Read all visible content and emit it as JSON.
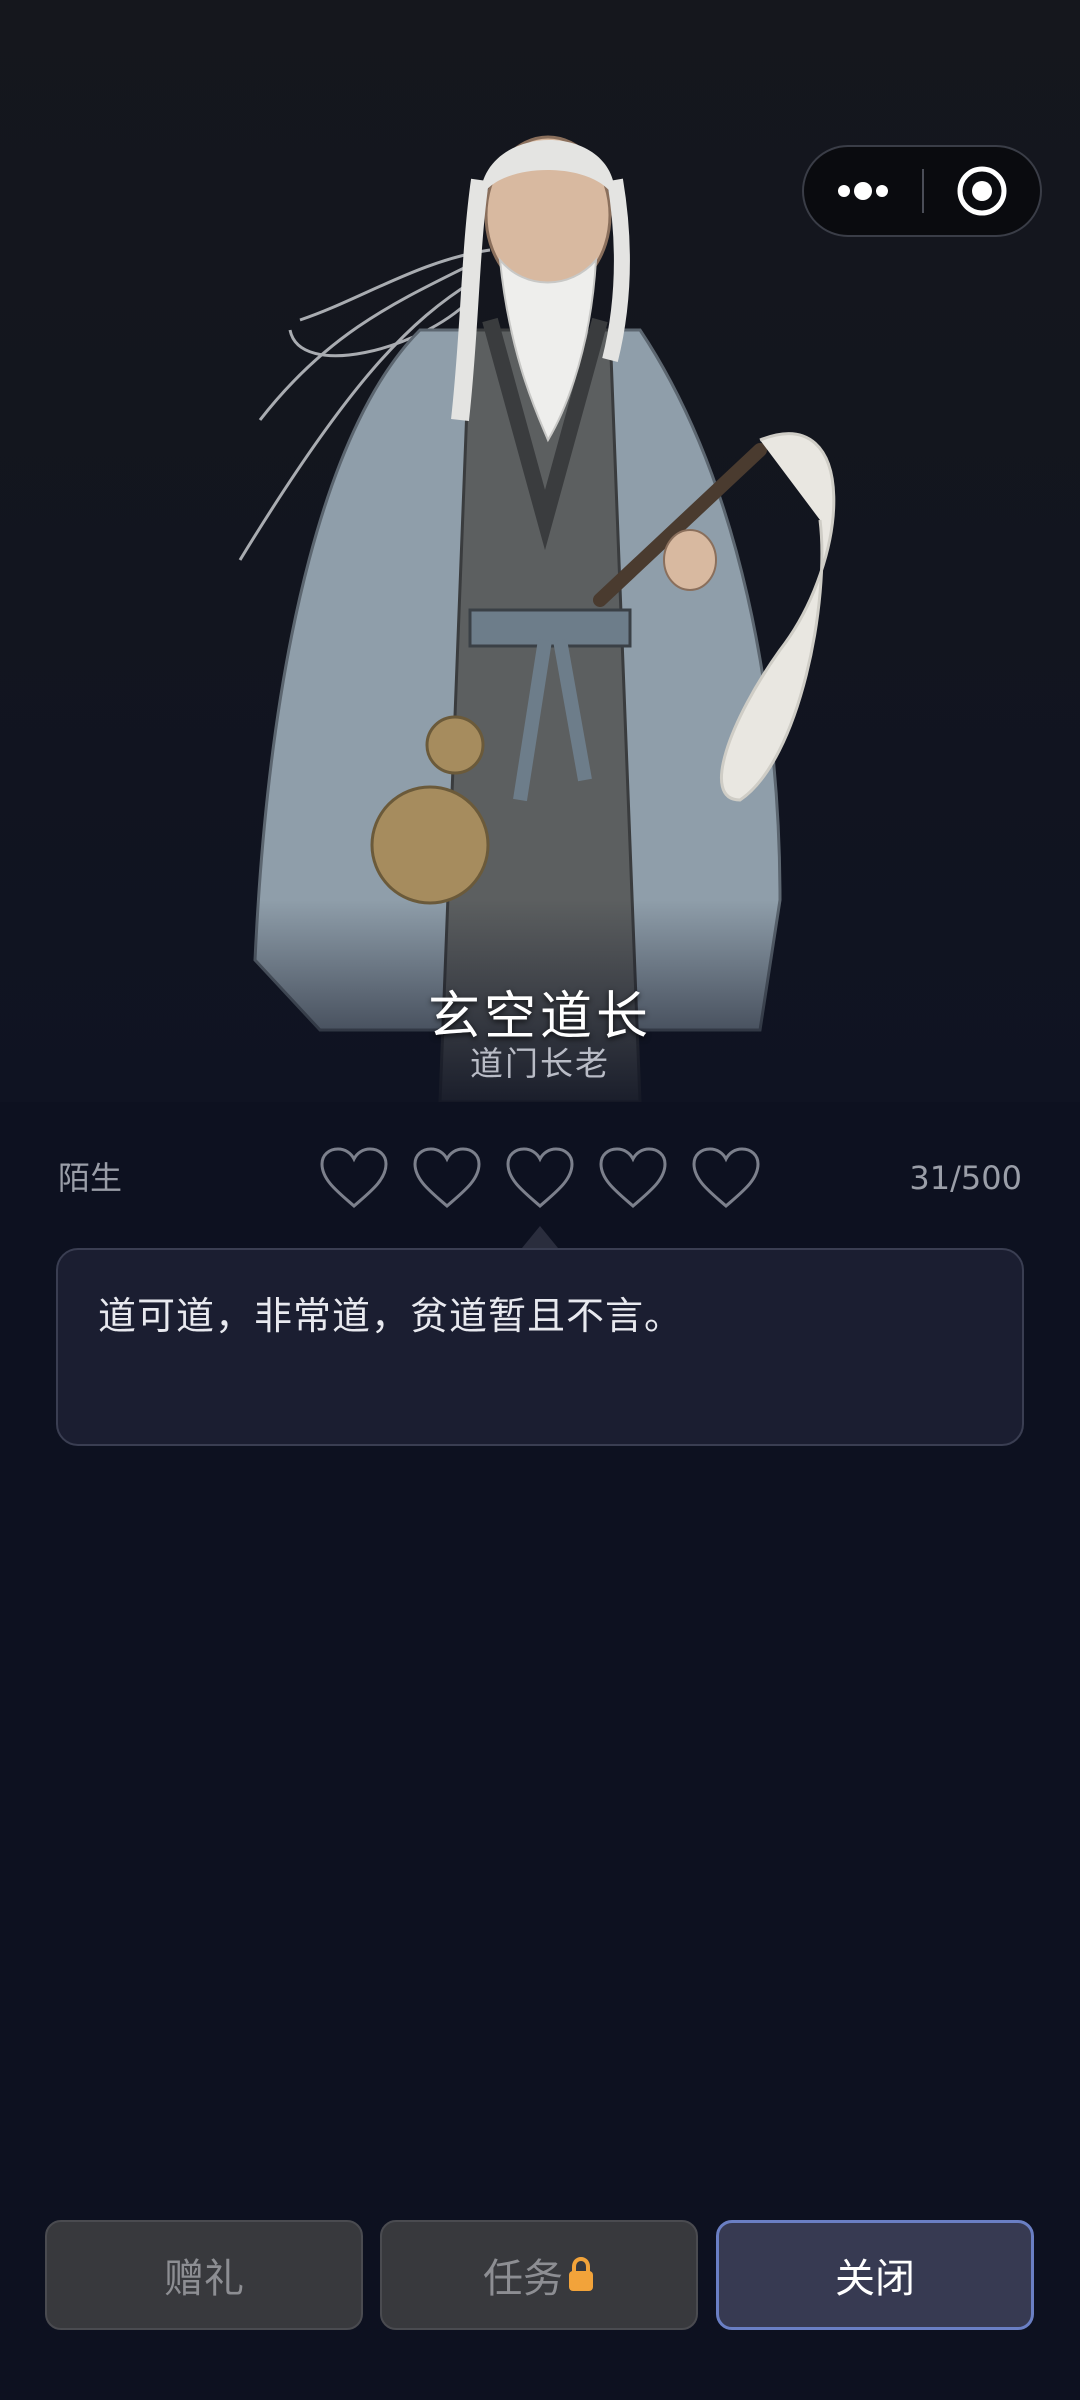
{
  "npc": {
    "name": "玄空道长",
    "title": "道门长老"
  },
  "capsule": {
    "more_icon": "more-dots-icon",
    "close_icon": "target-circle-icon"
  },
  "affinity": {
    "relation": "陌生",
    "hearts_total": 5,
    "hearts_filled": 0,
    "value": "31/500",
    "heart_icon": "heart-outline-icon"
  },
  "dialogue": {
    "text": "道可道，非常道，贫道暂且不言。"
  },
  "actions": {
    "gift_label": "赠礼",
    "task_label": "任务",
    "task_locked_icon": "lock-icon",
    "close_label": "关闭"
  },
  "colors": {
    "background": "#0d1120",
    "dialogue_bg": "#1b1e31",
    "close_border": "#6a7fc4",
    "lock": "#f2a33a"
  }
}
